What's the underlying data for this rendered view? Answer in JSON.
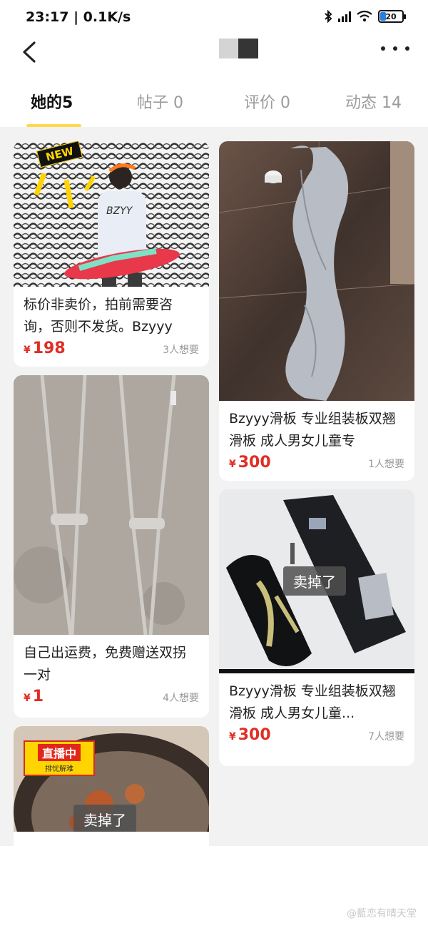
{
  "status_bar": {
    "time": "23:17",
    "network_speed": "| 0.1K/s",
    "battery": "20",
    "bluetooth_icon": "bluetooth-icon",
    "signal_icon": "signal-icon",
    "wifi_icon": "wifi-icon"
  },
  "nav": {
    "back_icon": "chevron-left-icon",
    "more_icon": "ellipsis-icon"
  },
  "tabs": [
    {
      "label": "她的5",
      "active": true
    },
    {
      "label": "帖子 0",
      "active": false
    },
    {
      "label": "评价 0",
      "active": false
    },
    {
      "label": "动态 14",
      "active": false
    }
  ],
  "items": [
    {
      "title": "标价非卖价，拍前需要咨询，否则不发货。Bzyyy",
      "price": "198",
      "currency": "¥",
      "want": "3人想要",
      "badge": "NEW"
    },
    {
      "title": "Bzyyy滑板 专业组装板双翘滑板 成人男女儿童专",
      "price": "300",
      "currency": "¥",
      "want": "1人想要"
    },
    {
      "title": "自己出运费，免费赠送双拐一对",
      "price": "1",
      "currency": "¥",
      "want": "4人想要"
    },
    {
      "title": "Bzyyy滑板 专业组装板双翘滑板 成人男女儿童...",
      "price": "300",
      "currency": "¥",
      "want": "7人想要",
      "sold_label": "卖掉了"
    },
    {
      "live_label": "直播中",
      "live_sub": "排忧解难",
      "sold_label": "卖掉了"
    }
  ],
  "watermark": "@藍恋有晴天堂",
  "colors": {
    "accent_yellow": "#ffd84a",
    "price_red": "#e02e24",
    "feed_bg": "#f2f2f2"
  }
}
